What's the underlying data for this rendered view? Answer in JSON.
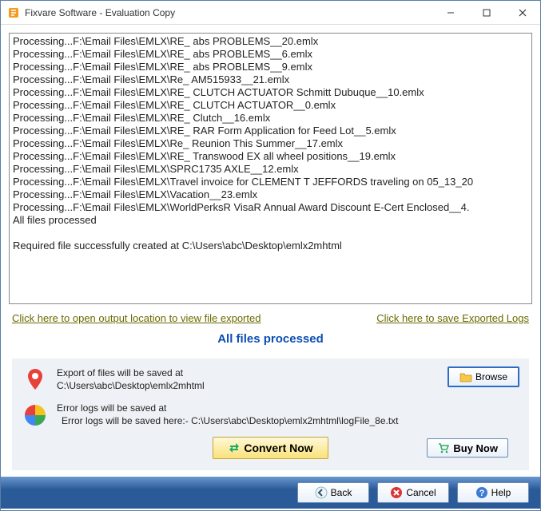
{
  "window": {
    "title": "Fixvare Software - Evaluation Copy"
  },
  "log": {
    "lines": [
      "Processing...F:\\Email Files\\EMLX\\RE_ abs PROBLEMS__20.emlx",
      "Processing...F:\\Email Files\\EMLX\\RE_ abs PROBLEMS__6.emlx",
      "Processing...F:\\Email Files\\EMLX\\RE_ abs PROBLEMS__9.emlx",
      "Processing...F:\\Email Files\\EMLX\\Re_ AM515933__21.emlx",
      "Processing...F:\\Email Files\\EMLX\\RE_ CLUTCH ACTUATOR Schmitt Dubuque__10.emlx",
      "Processing...F:\\Email Files\\EMLX\\RE_ CLUTCH ACTUATOR__0.emlx",
      "Processing...F:\\Email Files\\EMLX\\RE_ Clutch__16.emlx",
      "Processing...F:\\Email Files\\EMLX\\RE_ RAR Form Application for Feed Lot__5.emlx",
      "Processing...F:\\Email Files\\EMLX\\Re_ Reunion This Summer__17.emlx",
      "Processing...F:\\Email Files\\EMLX\\RE_ Transwood EX all wheel positions__19.emlx",
      "Processing...F:\\Email Files\\EMLX\\SPRC1735 AXLE__12.emlx",
      "Processing...F:\\Email Files\\EMLX\\Travel invoice for CLEMENT T JEFFORDS traveling on 05_13_20",
      "Processing...F:\\Email Files\\EMLX\\Vacation__23.emlx",
      "Processing...F:\\Email Files\\EMLX\\WorldPerksR VisaR Annual Award Discount E-Cert Enclosed__4.",
      "All files processed",
      "",
      "Required file successfully created at C:\\Users\\abc\\Desktop\\emlx2mhtml"
    ]
  },
  "links": {
    "open_output": "Click here to open output location to view file exported",
    "save_logs": "Click here to save Exported Logs"
  },
  "status": "All files processed",
  "export": {
    "label": "Export of files will be saved at",
    "path": "C:\\Users\\abc\\Desktop\\emlx2mhtml",
    "browse_label": "Browse"
  },
  "errors": {
    "label": "Error logs will be saved at",
    "path": "Error logs will be saved here:- C:\\Users\\abc\\Desktop\\emlx2mhtml\\logFile_8e.txt"
  },
  "actions": {
    "convert": "Convert Now",
    "buy": "Buy Now"
  },
  "footer": {
    "back": "Back",
    "cancel": "Cancel",
    "help": "Help"
  }
}
